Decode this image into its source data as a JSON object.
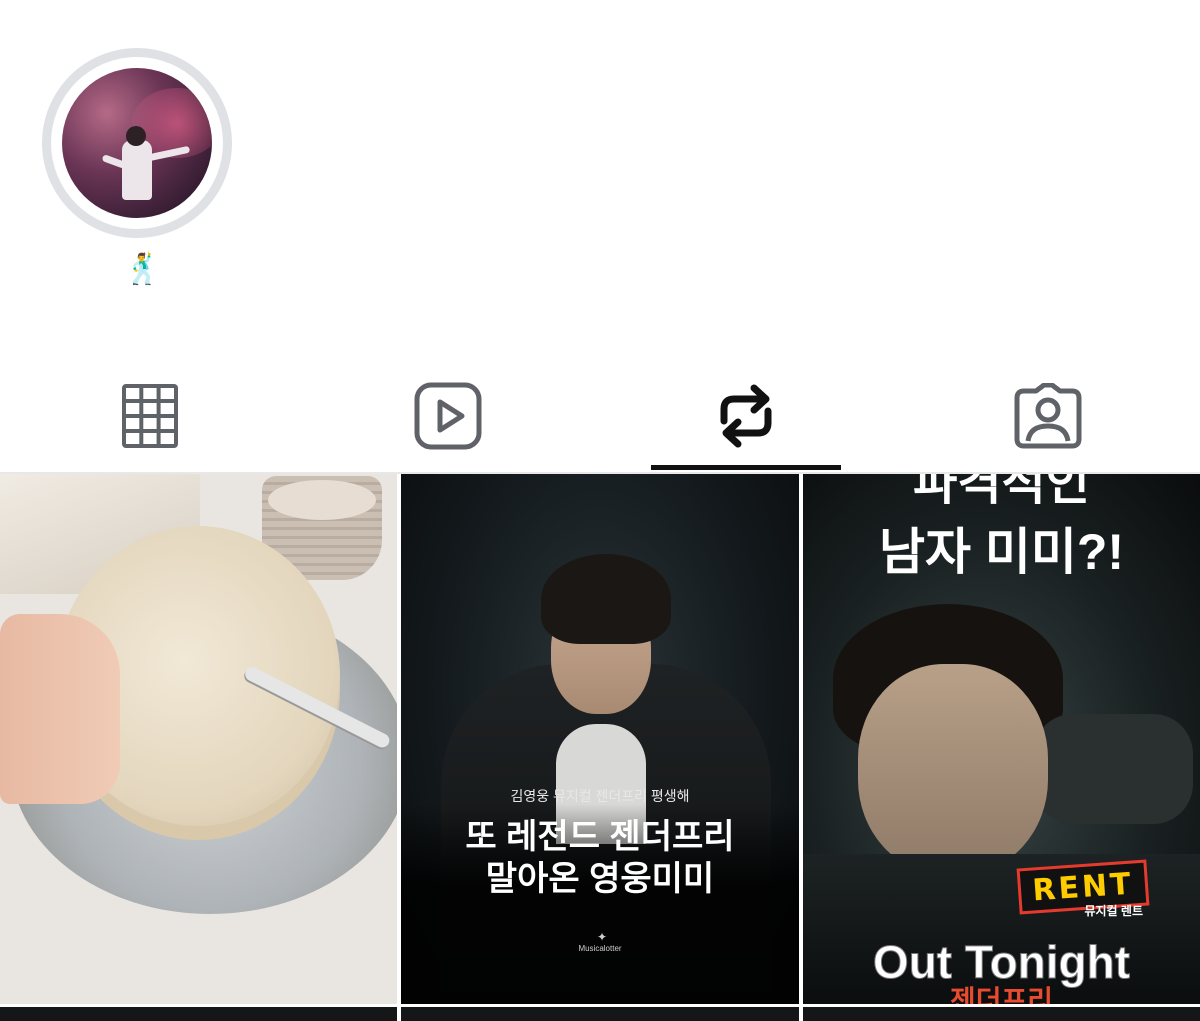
{
  "profile": {
    "avatar_name": "profile-avatar",
    "bio_emoji": "🕺"
  },
  "tabs": [
    {
      "name": "posts-grid",
      "icon": "grid-icon",
      "active": false
    },
    {
      "name": "reels",
      "icon": "play-square-icon",
      "active": false
    },
    {
      "name": "reposts",
      "icon": "repost-icon",
      "active": true
    },
    {
      "name": "tagged",
      "icon": "tagged-person-icon",
      "active": false
    }
  ],
  "posts": [
    {
      "description_hidden": true
    },
    {
      "subtitle": "김영웅 뮤지컬 젠더프리 평생해",
      "title_line1": "또 레전드 젠더프리",
      "title_line2": "말아온 영웅미미",
      "watermark": "Musicalotter"
    },
    {
      "title_line1": "파격적인",
      "title_line2": "남자 미미?!",
      "logo_text": "RENT",
      "logo_sub": "뮤지컬 렌트",
      "caption": "Out Tonight",
      "bottom_text": "젠더프리"
    }
  ],
  "colors": {
    "accent": "#111111",
    "tab_icon": "#5f6368",
    "ring": "#dfe1e5"
  }
}
